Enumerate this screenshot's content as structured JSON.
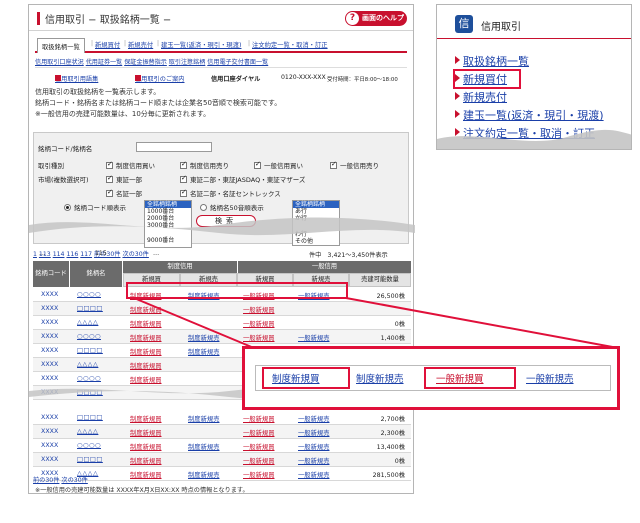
{
  "main": {
    "title": "信用取引 − 取扱銘柄一覧 −",
    "help": "画面のヘルプ",
    "tabs": [
      "取扱銘柄一覧",
      "新規買付",
      "新規売付",
      "建玉一覧(返済・現引・現渡)",
      "注文約定一覧・取消・訂正"
    ],
    "subtabs": [
      "信用取引口座状況",
      "代用証券一覧",
      "保証金振替指示",
      "取引注意銘柄",
      "信用電子交付書面一覧"
    ],
    "info": {
      "link1": "信用取引用語集",
      "link2": "信用取引のご案内",
      "tel_label": "信用口座ダイヤル",
      "tel": "0120-XXX-XXX",
      "hours": "受付時間：平日8:00〜18:00"
    },
    "intro": [
      "信用取引の取扱銘柄を一覧表示します。",
      "銘柄コード・銘柄名または銘柄コード順または企業名50音順で検索可能です。",
      "※一般信用の売建可能数量は、10分毎に更新されます。"
    ]
  },
  "search": {
    "code_label": "銘柄コード/銘柄名",
    "type_label": "取引種別",
    "types": [
      "制度信用買い",
      "制度信用売り",
      "一般信用買い",
      "一般信用売り"
    ],
    "market_label": "市場(複数選択可)",
    "markets": [
      "東証一部",
      "東証二部・東証JASDAQ・東証マザーズ",
      "名証一部",
      "名証二部・名証セントレックス"
    ],
    "sort_code": "銘柄コード順表示",
    "sort_kana": "銘柄名50音順表示",
    "code_list": [
      "全銘柄銘柄",
      "1000番台",
      "2000番台",
      "3000番台",
      "9000番台"
    ],
    "kana_list": [
      "全銘柄銘柄",
      "あ行",
      "か行",
      "わ行",
      "その他"
    ],
    "button": "検索"
  },
  "pager": {
    "first": "1",
    "pages": [
      "113",
      "114",
      "115",
      "116",
      "117"
    ],
    "current": "115",
    "dots": "…",
    "summary": "件中　3,421〜3,450件表示",
    "prev": "前の30件",
    "next": "次の30件"
  },
  "table": {
    "head_code": "銘柄コード",
    "head_name": "銘柄名",
    "group_seido": "制度信用",
    "group_ippan": "一般信用",
    "sub": [
      "新規買",
      "新規売",
      "新規買",
      "新規売",
      "売建可能数量"
    ],
    "rows": [
      {
        "code": "XXXX",
        "name": "○○○○",
        "l1": "制度新規買",
        "l2": "制度新規売",
        "l3": "一般新規買",
        "l4": "一般新規売",
        "qty": "26,500株"
      },
      {
        "code": "XXXX",
        "name": "□□□□",
        "l1": "制度新規買",
        "l2": "",
        "l3": "一般新規買",
        "l4": "",
        "qty": ""
      },
      {
        "code": "XXXX",
        "name": "△△△△",
        "l1": "制度新規買",
        "l2": "",
        "l3": "一般新規買",
        "l4": "",
        "qty": "0株"
      },
      {
        "code": "XXXX",
        "name": "○○○○",
        "l1": "制度新規買",
        "l2": "制度新規売",
        "l3": "一般新規買",
        "l4": "一般新規売",
        "qty": "1,400株"
      },
      {
        "code": "XXXX",
        "name": "□□□□",
        "l1": "制度新規買",
        "l2": "制度新規売",
        "l3": "一般新規買",
        "l4": "一般新規売",
        "qty": "0株"
      },
      {
        "code": "XXXX",
        "name": "△△△△",
        "l1": "制度新規買",
        "l2": "",
        "l3": "",
        "l4": "",
        "qty": ""
      },
      {
        "code": "XXXX",
        "name": "○○○○",
        "l1": "制度新規買",
        "l2": "",
        "l3": "",
        "l4": "",
        "qty": ""
      },
      {
        "code": "XXXX",
        "name": "□□□□",
        "l1": "",
        "l2": "",
        "l3": "",
        "l4": "",
        "qty": ""
      }
    ],
    "rows_bottom": [
      {
        "code": "XXXX",
        "name": "□□□□",
        "l1": "制度新規買",
        "l2": "制度新規売",
        "l3": "一般新規買",
        "l4": "一般新規売",
        "qty": "2,700株"
      },
      {
        "code": "XXXX",
        "name": "△△△△",
        "l1": "制度新規買",
        "l2": "",
        "l3": "一般新規買",
        "l4": "一般新規売",
        "qty": "2,300株"
      },
      {
        "code": "XXXX",
        "name": "○○○○",
        "l1": "制度新規買",
        "l2": "制度新規売",
        "l3": "一般新規買",
        "l4": "一般新規売",
        "qty": "13,400株"
      },
      {
        "code": "XXXX",
        "name": "□□□□",
        "l1": "制度新規買",
        "l2": "",
        "l3": "一般新規買",
        "l4": "一般新規売",
        "qty": "0株"
      },
      {
        "code": "XXXX",
        "name": "△△△△",
        "l1": "制度新規買",
        "l2": "制度新規売",
        "l3": "一般新規買",
        "l4": "一般新規売",
        "qty": "281,500株"
      }
    ],
    "footnote": "※一般信用の売建可能数量は XXXX年X月X日XX:XX 時点の情報となります。"
  },
  "callout": {
    "links": [
      "制度新規買",
      "制度新規売",
      "一般新規買",
      "一般新規売"
    ]
  },
  "side": {
    "icon": "信",
    "title": "信用取引",
    "items": [
      "取扱銘柄一覧",
      "新規買付",
      "新規売付",
      "建玉一覧(返済・現引・現渡)",
      "注文約定一覧・取消・訂正"
    ]
  },
  "colors": {
    "accent": "#c8102e",
    "link": "#1a3fa8",
    "highlight": "#e0103a",
    "header": "#6b6b6b"
  }
}
